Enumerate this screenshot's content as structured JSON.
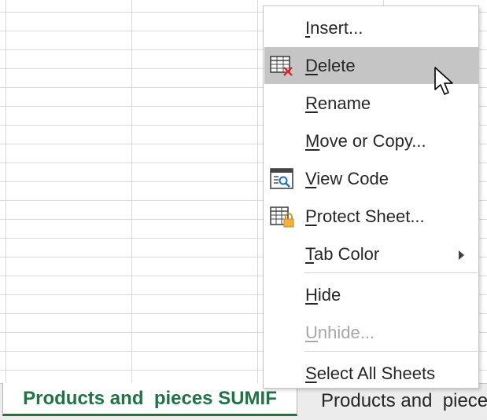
{
  "context_menu": {
    "items": [
      {
        "label_pre": "",
        "label_key": "I",
        "label_post": "nsert...",
        "icon": null,
        "state": "normal"
      },
      {
        "label_pre": "",
        "label_key": "D",
        "label_post": "elete",
        "icon": "delete-sheet-icon",
        "state": "hover"
      },
      {
        "label_pre": "",
        "label_key": "R",
        "label_post": "ename",
        "icon": null,
        "state": "normal"
      },
      {
        "label_pre": "",
        "label_key": "M",
        "label_post": "ove or Copy...",
        "icon": null,
        "state": "normal"
      },
      {
        "label_pre": "",
        "label_key": "V",
        "label_post": "iew Code",
        "icon": "view-code-icon",
        "state": "normal"
      },
      {
        "label_pre": "",
        "label_key": "P",
        "label_post": "rotect Sheet...",
        "icon": "protect-sheet-icon",
        "state": "normal"
      },
      {
        "label_pre": "",
        "label_key": "T",
        "label_post": "ab Color",
        "icon": null,
        "state": "normal",
        "submenu": true
      },
      {
        "label_pre": "",
        "label_key": "H",
        "label_post": "ide",
        "icon": null,
        "state": "normal"
      },
      {
        "label_pre": "",
        "label_key": "U",
        "label_post": "nhide...",
        "icon": null,
        "state": "disabled"
      },
      {
        "label_pre": "",
        "label_key": "S",
        "label_post": "elect All Sheets",
        "icon": null,
        "state": "normal"
      }
    ]
  },
  "sheet_tabs": {
    "active": "Products and  pieces SUMIF",
    "inactive": "Products and  pieces"
  },
  "colors": {
    "accent": "#217346",
    "hover": "#c5c5c5",
    "disabled_text": "#a6a6a6"
  }
}
